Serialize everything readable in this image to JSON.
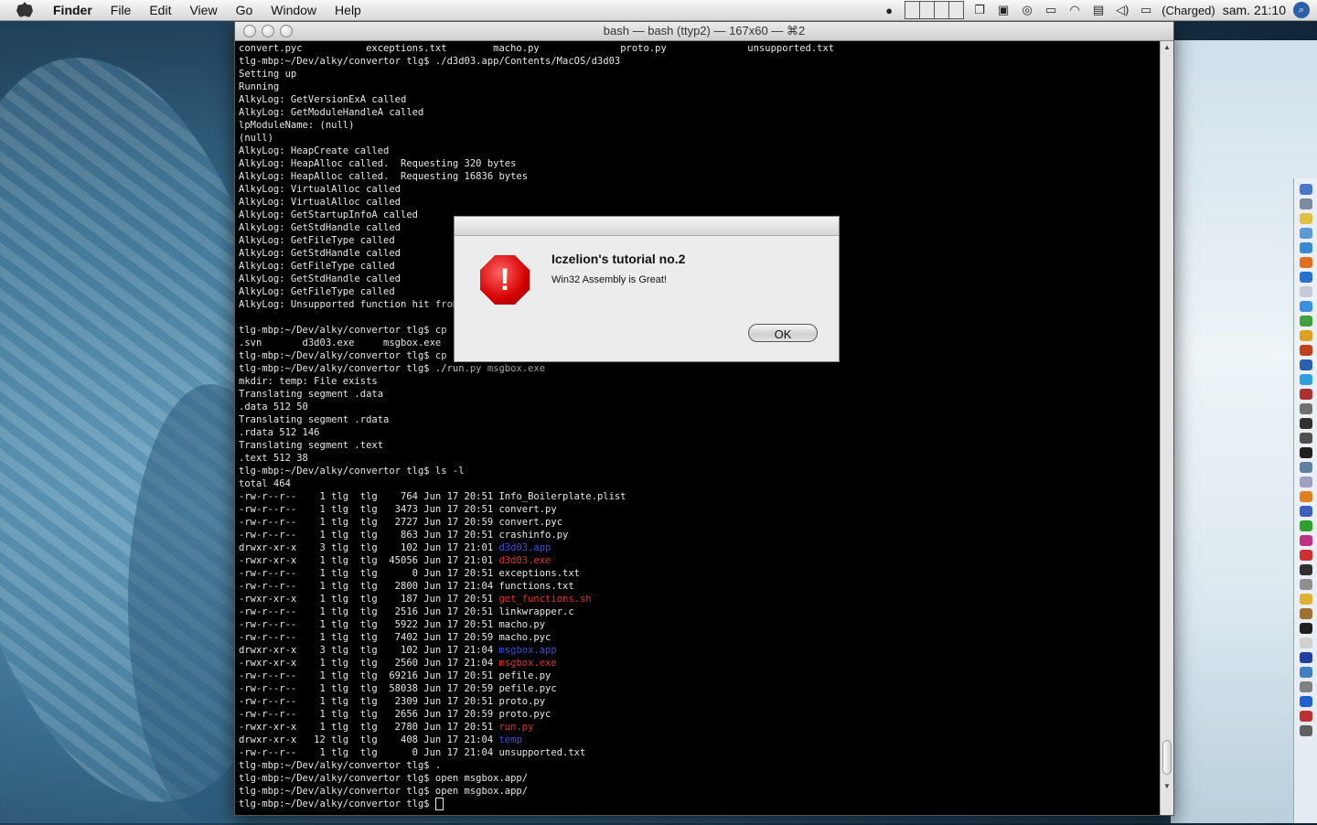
{
  "menubar": {
    "app_name": "Finder",
    "items": [
      "File",
      "Edit",
      "View",
      "Go",
      "Window",
      "Help"
    ],
    "battery_status": "(Charged)",
    "clock": "sam. 21:10"
  },
  "terminal": {
    "title": "bash — bash (ttyp2) — 167x60 — ⌘2",
    "lines": [
      [
        {
          "t": "convert.pyc           exceptions.txt        macho.py              proto.py              unsupported.txt"
        }
      ],
      [
        {
          "t": "tlg-mbp:~/Dev/alky/convertor tlg$ ./d3d03.app/Contents/MacOS/d3d03"
        }
      ],
      [
        {
          "t": "Setting up"
        }
      ],
      [
        {
          "t": "Running"
        }
      ],
      [
        {
          "t": "AlkyLog: GetVersionExA called"
        }
      ],
      [
        {
          "t": "AlkyLog: GetModuleHandleA called"
        }
      ],
      [
        {
          "t": "lpModuleName: (null)"
        }
      ],
      [
        {
          "t": "(null)"
        }
      ],
      [
        {
          "t": "AlkyLog: HeapCreate called"
        }
      ],
      [
        {
          "t": "AlkyLog: HeapAlloc called.  Requesting 320 bytes"
        }
      ],
      [
        {
          "t": "AlkyLog: HeapAlloc called.  Requesting 16836 bytes"
        }
      ],
      [
        {
          "t": "AlkyLog: VirtualAlloc called"
        }
      ],
      [
        {
          "t": "AlkyLog: VirtualAlloc called"
        }
      ],
      [
        {
          "t": "AlkyLog: GetStartupInfoA called"
        }
      ],
      [
        {
          "t": "AlkyLog: GetStdHandle called"
        }
      ],
      [
        {
          "t": "AlkyLog: GetFileType called"
        }
      ],
      [
        {
          "t": "AlkyLog: GetStdHandle called"
        }
      ],
      [
        {
          "t": "AlkyLog: GetFileType called"
        }
      ],
      [
        {
          "t": "AlkyLog: GetStdHandle called"
        }
      ],
      [
        {
          "t": "AlkyLog: GetFileType called"
        }
      ],
      [
        {
          "t": "AlkyLog: Unsupported function hit from"
        }
      ],
      [
        {
          "t": ""
        }
      ],
      [
        {
          "t": "tlg-mbp:~/Dev/alky/convertor tlg$ cp .."
        }
      ],
      [
        {
          "t": ".svn       d3d03.exe     msgbox.exe"
        }
      ],
      [
        {
          "t": "tlg-mbp:~/Dev/alky/convertor tlg$ cp .."
        }
      ],
      [
        {
          "t": "tlg-mbp:~/Dev/alky/convertor tlg$ ./run.py msgbox.exe"
        }
      ],
      [
        {
          "t": "mkdir: temp: File exists"
        }
      ],
      [
        {
          "t": "Translating segment .data"
        }
      ],
      [
        {
          "t": ".data 512 50"
        }
      ],
      [
        {
          "t": "Translating segment .rdata"
        }
      ],
      [
        {
          "t": ".rdata 512 146"
        }
      ],
      [
        {
          "t": "Translating segment .text"
        }
      ],
      [
        {
          "t": ".text 512 38"
        }
      ],
      [
        {
          "t": "tlg-mbp:~/Dev/alky/convertor tlg$ ls -l"
        }
      ],
      [
        {
          "t": "total 464"
        }
      ],
      [
        {
          "t": "-rw-r--r--    1 tlg  tlg    764 Jun 17 20:51 "
        },
        {
          "t": "Info_Boilerplate.plist"
        }
      ],
      [
        {
          "t": "-rw-r--r--    1 tlg  tlg   3473 Jun 17 20:51 "
        },
        {
          "t": "convert.py"
        }
      ],
      [
        {
          "t": "-rw-r--r--    1 tlg  tlg   2727 Jun 17 20:59 "
        },
        {
          "t": "convert.pyc"
        }
      ],
      [
        {
          "t": "-rw-r--r--    1 tlg  tlg    863 Jun 17 20:51 "
        },
        {
          "t": "crashinfo.py"
        }
      ],
      [
        {
          "t": "drwxr-xr-x    3 tlg  tlg    102 Jun 17 21:01 "
        },
        {
          "t": "d3d03.app",
          "c": "c-blue"
        }
      ],
      [
        {
          "t": "-rwxr-xr-x    1 tlg  tlg  45056 Jun 17 21:01 "
        },
        {
          "t": "d3d03.exe",
          "c": "c-red"
        }
      ],
      [
        {
          "t": "-rw-r--r--    1 tlg  tlg      0 Jun 17 20:51 "
        },
        {
          "t": "exceptions.txt"
        }
      ],
      [
        {
          "t": "-rw-r--r--    1 tlg  tlg   2800 Jun 17 21:04 "
        },
        {
          "t": "functions.txt"
        }
      ],
      [
        {
          "t": "-rwxr-xr-x    1 tlg  tlg    187 Jun 17 20:51 "
        },
        {
          "t": "get_functions.sh",
          "c": "c-red"
        }
      ],
      [
        {
          "t": "-rw-r--r--    1 tlg  tlg   2516 Jun 17 20:51 "
        },
        {
          "t": "linkwrapper.c"
        }
      ],
      [
        {
          "t": "-rw-r--r--    1 tlg  tlg   5922 Jun 17 20:51 "
        },
        {
          "t": "macho.py"
        }
      ],
      [
        {
          "t": "-rw-r--r--    1 tlg  tlg   7402 Jun 17 20:59 "
        },
        {
          "t": "macho.pyc"
        }
      ],
      [
        {
          "t": "drwxr-xr-x    3 tlg  tlg    102 Jun 17 21:04 "
        },
        {
          "t": "msgbox.app",
          "c": "c-blue"
        }
      ],
      [
        {
          "t": "-rwxr-xr-x    1 tlg  tlg   2560 Jun 17 21:04 "
        },
        {
          "t": "msgbox.exe",
          "c": "c-red"
        }
      ],
      [
        {
          "t": "-rw-r--r--    1 tlg  tlg  69216 Jun 17 20:51 "
        },
        {
          "t": "pefile.py"
        }
      ],
      [
        {
          "t": "-rw-r--r--    1 tlg  tlg  58038 Jun 17 20:59 "
        },
        {
          "t": "pefile.pyc"
        }
      ],
      [
        {
          "t": "-rw-r--r--    1 tlg  tlg   2309 Jun 17 20:51 "
        },
        {
          "t": "proto.py"
        }
      ],
      [
        {
          "t": "-rw-r--r--    1 tlg  tlg   2656 Jun 17 20:59 "
        },
        {
          "t": "proto.pyc"
        }
      ],
      [
        {
          "t": "-rwxr-xr-x    1 tlg  tlg   2780 Jun 17 20:51 "
        },
        {
          "t": "run.py",
          "c": "c-red"
        }
      ],
      [
        {
          "t": "drwxr-xr-x   12 tlg  tlg    408 Jun 17 21:04 "
        },
        {
          "t": "temp",
          "c": "c-blue"
        }
      ],
      [
        {
          "t": "-rw-r--r--    1 tlg  tlg      0 Jun 17 21:04 "
        },
        {
          "t": "unsupported.txt"
        }
      ],
      [
        {
          "t": "tlg-mbp:~/Dev/alky/convertor tlg$ ."
        }
      ],
      [
        {
          "t": "tlg-mbp:~/Dev/alky/convertor tlg$ open msgbox.app/"
        }
      ],
      [
        {
          "t": "tlg-mbp:~/Dev/alky/convertor tlg$ open msgbox.app/"
        }
      ],
      [
        {
          "t": "tlg-mbp:~/Dev/alky/convertor tlg$ "
        }
      ]
    ]
  },
  "dialog": {
    "title": "Iczelion's tutorial no.2",
    "message": "Win32 Assembly is Great!",
    "ok_label": "OK",
    "icon": "stop-icon"
  },
  "dock": {
    "icon_colors": [
      "#4a78c8",
      "#7a8aa0",
      "#e0c040",
      "#5a9ad8",
      "#3a8ad0",
      "#e07020",
      "#2a70d0",
      "#c8c8d8",
      "#3a90e0",
      "#40a040",
      "#e0a020",
      "#c04020",
      "#2a60b0",
      "#30a0e0",
      "#b03030",
      "#707070",
      "#303030",
      "#505050",
      "#202020",
      "#6080a0",
      "#a0a0c0",
      "#e08020",
      "#4060c0",
      "#30a030",
      "#c03080",
      "#d03030",
      "#303030",
      "#909090",
      "#e0b030",
      "#a07030",
      "#202020",
      "#d0d0d0",
      "#2040a0",
      "#4080c0",
      "#808080",
      "#2060d0",
      "#c03030",
      "#606060"
    ]
  }
}
